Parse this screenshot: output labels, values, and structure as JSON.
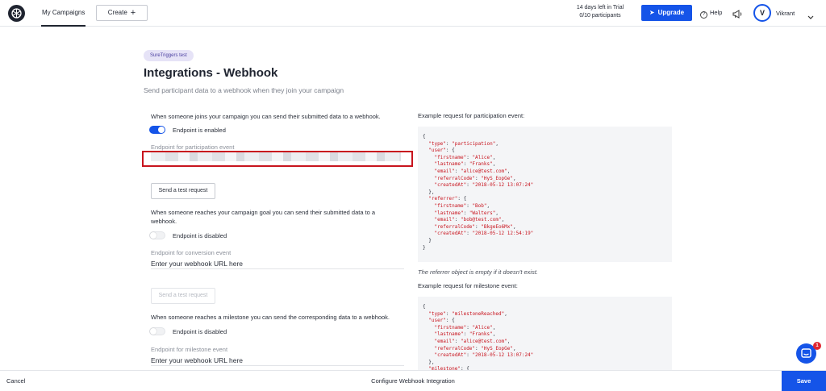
{
  "header": {
    "nav_tab": "My Campaigns",
    "create_label": "Create",
    "trial_line1": "14 days left in Trial",
    "trial_line2": "0/10 participants",
    "upgrade_label": "Upgrade",
    "help_label": "Help",
    "avatar_initial": "V",
    "user_name": "Vikrant"
  },
  "page": {
    "badge": "SureTriggers test",
    "title": "Integrations - Webhook",
    "subtitle": "Send participant data to a webhook when they join your campaign"
  },
  "participation": {
    "description": "When someone joins your campaign you can send their submitted data to a webhook.",
    "toggle_label": "Endpoint is enabled",
    "toggle_on": true,
    "field_label": "Endpoint for participation event",
    "test_button": "Send a test request"
  },
  "conversion": {
    "description_line1": "When someone reaches your campaign goal you can send their submitted data to a",
    "description_line2": "webhook.",
    "toggle_label": "Endpoint is disabled",
    "toggle_on": false,
    "field_label": "Endpoint for conversion event",
    "placeholder": "Enter your webhook URL here",
    "test_button": "Send a test request"
  },
  "milestone": {
    "description": "When someone reaches a milestone you can send the corresponding data to a webhook.",
    "toggle_label": "Endpoint is disabled",
    "toggle_on": false,
    "field_label": "Endpoint for milestone event",
    "placeholder": "Enter your webhook URL here"
  },
  "examples": {
    "participation_label": "Example request for participation event:",
    "referrer_note": "The referrer object is empty if it doesn't exist.",
    "milestone_label": "Example request for milestone event:",
    "participation_code": [
      "{",
      "  \"type\": \"participation\",",
      "  \"user\": {",
      "    \"firstname\": \"Alice\",",
      "    \"lastname\": \"Franks\",",
      "    \"email\": \"alice@test.com\",",
      "    \"referralCode\": \"HyS_EopGe\",",
      "    \"createdAt\": \"2018-05-12 13:07:24\"",
      "  },",
      "  \"referrer\": {",
      "    \"firstname\": \"Bob\",",
      "    \"lastname\": \"Walters\",",
      "    \"email\": \"bob@test.com\",",
      "    \"referralCode\": \"BkgeEo6Mx\",",
      "    \"createdAt\": \"2018-05-12 12:54:19\"",
      "  }",
      "}"
    ],
    "milestone_code": [
      "{",
      "  \"type\": \"milestoneReached\",",
      "  \"user\": {",
      "    \"firstname\": \"Alice\",",
      "    \"lastname\": \"Franks\",",
      "    \"email\": \"alice@test.com\",",
      "    \"referralCode\": \"HyS_EopGe\",",
      "    \"createdAt\": \"2018-05-12 13:07:24\"",
      "  },",
      "  \"milestone\": {"
    ]
  },
  "chat": {
    "unread": "1"
  },
  "footer": {
    "cancel_label": "Cancel",
    "title": "Configure Webhook Integration",
    "save_label": "Save"
  },
  "colors": {
    "primary": "#1554e8",
    "highlight": "#c8141e",
    "badge_bg": "#e6e3f7"
  }
}
